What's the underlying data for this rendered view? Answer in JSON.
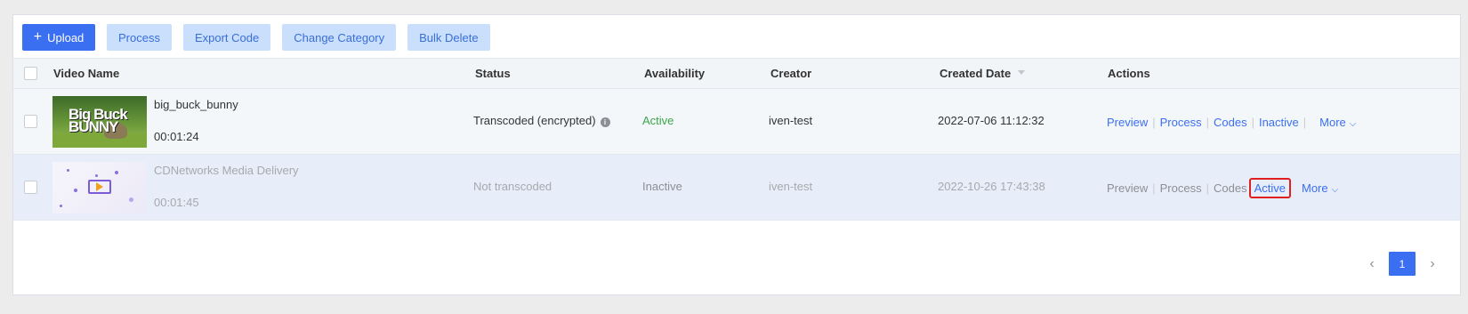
{
  "toolbar": {
    "upload_label": "Upload",
    "process_label": "Process",
    "export_label": "Export Code",
    "change_category_label": "Change Category",
    "bulk_delete_label": "Bulk Delete"
  },
  "table": {
    "headers": {
      "video_name": "Video Name",
      "status": "Status",
      "availability": "Availability",
      "creator": "Creator",
      "created_date": "Created Date",
      "actions": "Actions"
    },
    "rows": [
      {
        "name": "big_buck_bunny",
        "duration": "00:01:24",
        "thumb_text": "Big Buck BUNNY",
        "status": "Transcoded (encrypted)",
        "availability": "Active",
        "creator": "iven-test",
        "created_date": "2022-07-06 11:12:32",
        "actions": {
          "preview": "Preview",
          "process": "Process",
          "codes": "Codes",
          "toggle": "Inactive",
          "more": "More"
        }
      },
      {
        "name": "CDNetworks Media Delivery",
        "duration": "00:01:45",
        "status": "Not transcoded",
        "availability": "Inactive",
        "creator": "iven-test",
        "created_date": "2022-10-26 17:43:38",
        "actions": {
          "preview": "Preview",
          "process": "Process",
          "codes": "Codes",
          "toggle": "Active",
          "more": "More"
        }
      }
    ]
  },
  "pagination": {
    "current_page": "1"
  },
  "colors": {
    "primary": "#3b6ff2",
    "active_green": "#3aa54a",
    "highlight_red": "#e02020"
  }
}
